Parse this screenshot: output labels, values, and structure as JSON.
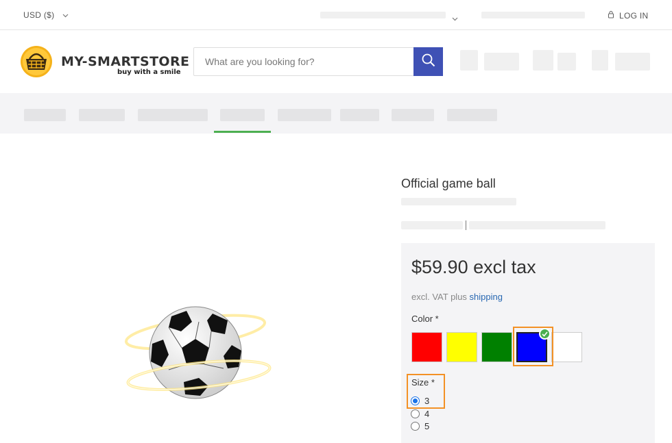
{
  "topbar": {
    "currency_label": "USD  ($)",
    "login_label": "LOG IN"
  },
  "brand": {
    "name": "MY-SMARTSTORE",
    "tagline": "buy with a smile"
  },
  "search": {
    "placeholder": "What are you looking for?",
    "value": ""
  },
  "product": {
    "title": "Official game ball",
    "price": "$59.90 excl tax",
    "vat_prefix": "excl. VAT plus ",
    "vat_link": "shipping",
    "color_label": "Color *",
    "colors": [
      {
        "name": "red",
        "hex": "#ff0000"
      },
      {
        "name": "yellow",
        "hex": "#ffff00"
      },
      {
        "name": "green",
        "hex": "#008000"
      },
      {
        "name": "blue",
        "hex": "#0000ff"
      },
      {
        "name": "white",
        "hex": "#ffffff"
      }
    ],
    "selected_color": "blue",
    "size_label": "Size *",
    "sizes": [
      "3",
      "4",
      "5"
    ],
    "selected_size": "3"
  },
  "colors": {
    "accent": "#3f51b5",
    "nav_active": "#4caf50",
    "highlight": "#f39125",
    "link": "#2767b1"
  }
}
